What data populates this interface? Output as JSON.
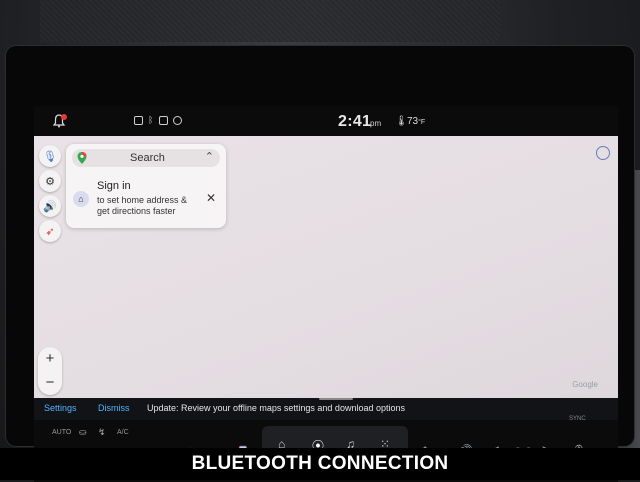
{
  "status_bar": {
    "time": "2:41",
    "ampm": "pm",
    "temperature": "73",
    "temp_unit": "°F"
  },
  "map": {
    "search": {
      "label": "Search"
    },
    "signin": {
      "title": "Sign in",
      "subtitle": "to set home address & get directions faster"
    },
    "attribution": "Google"
  },
  "notification": {
    "settings_label": "Settings",
    "dismiss_label": "Dismiss",
    "message": "Update: Review your offline maps settings and download options"
  },
  "climate": {
    "auto_label": "AUTO",
    "ac_label": "A/C",
    "left_temp": "- -",
    "right_temp": "- -",
    "sync_label": "SYNC"
  },
  "caption": "BLUETOOTH CONNECTION",
  "colors": {
    "accent": "#4fb3ff",
    "map_bg": "#e6dfe3",
    "alert": "#e53935"
  }
}
